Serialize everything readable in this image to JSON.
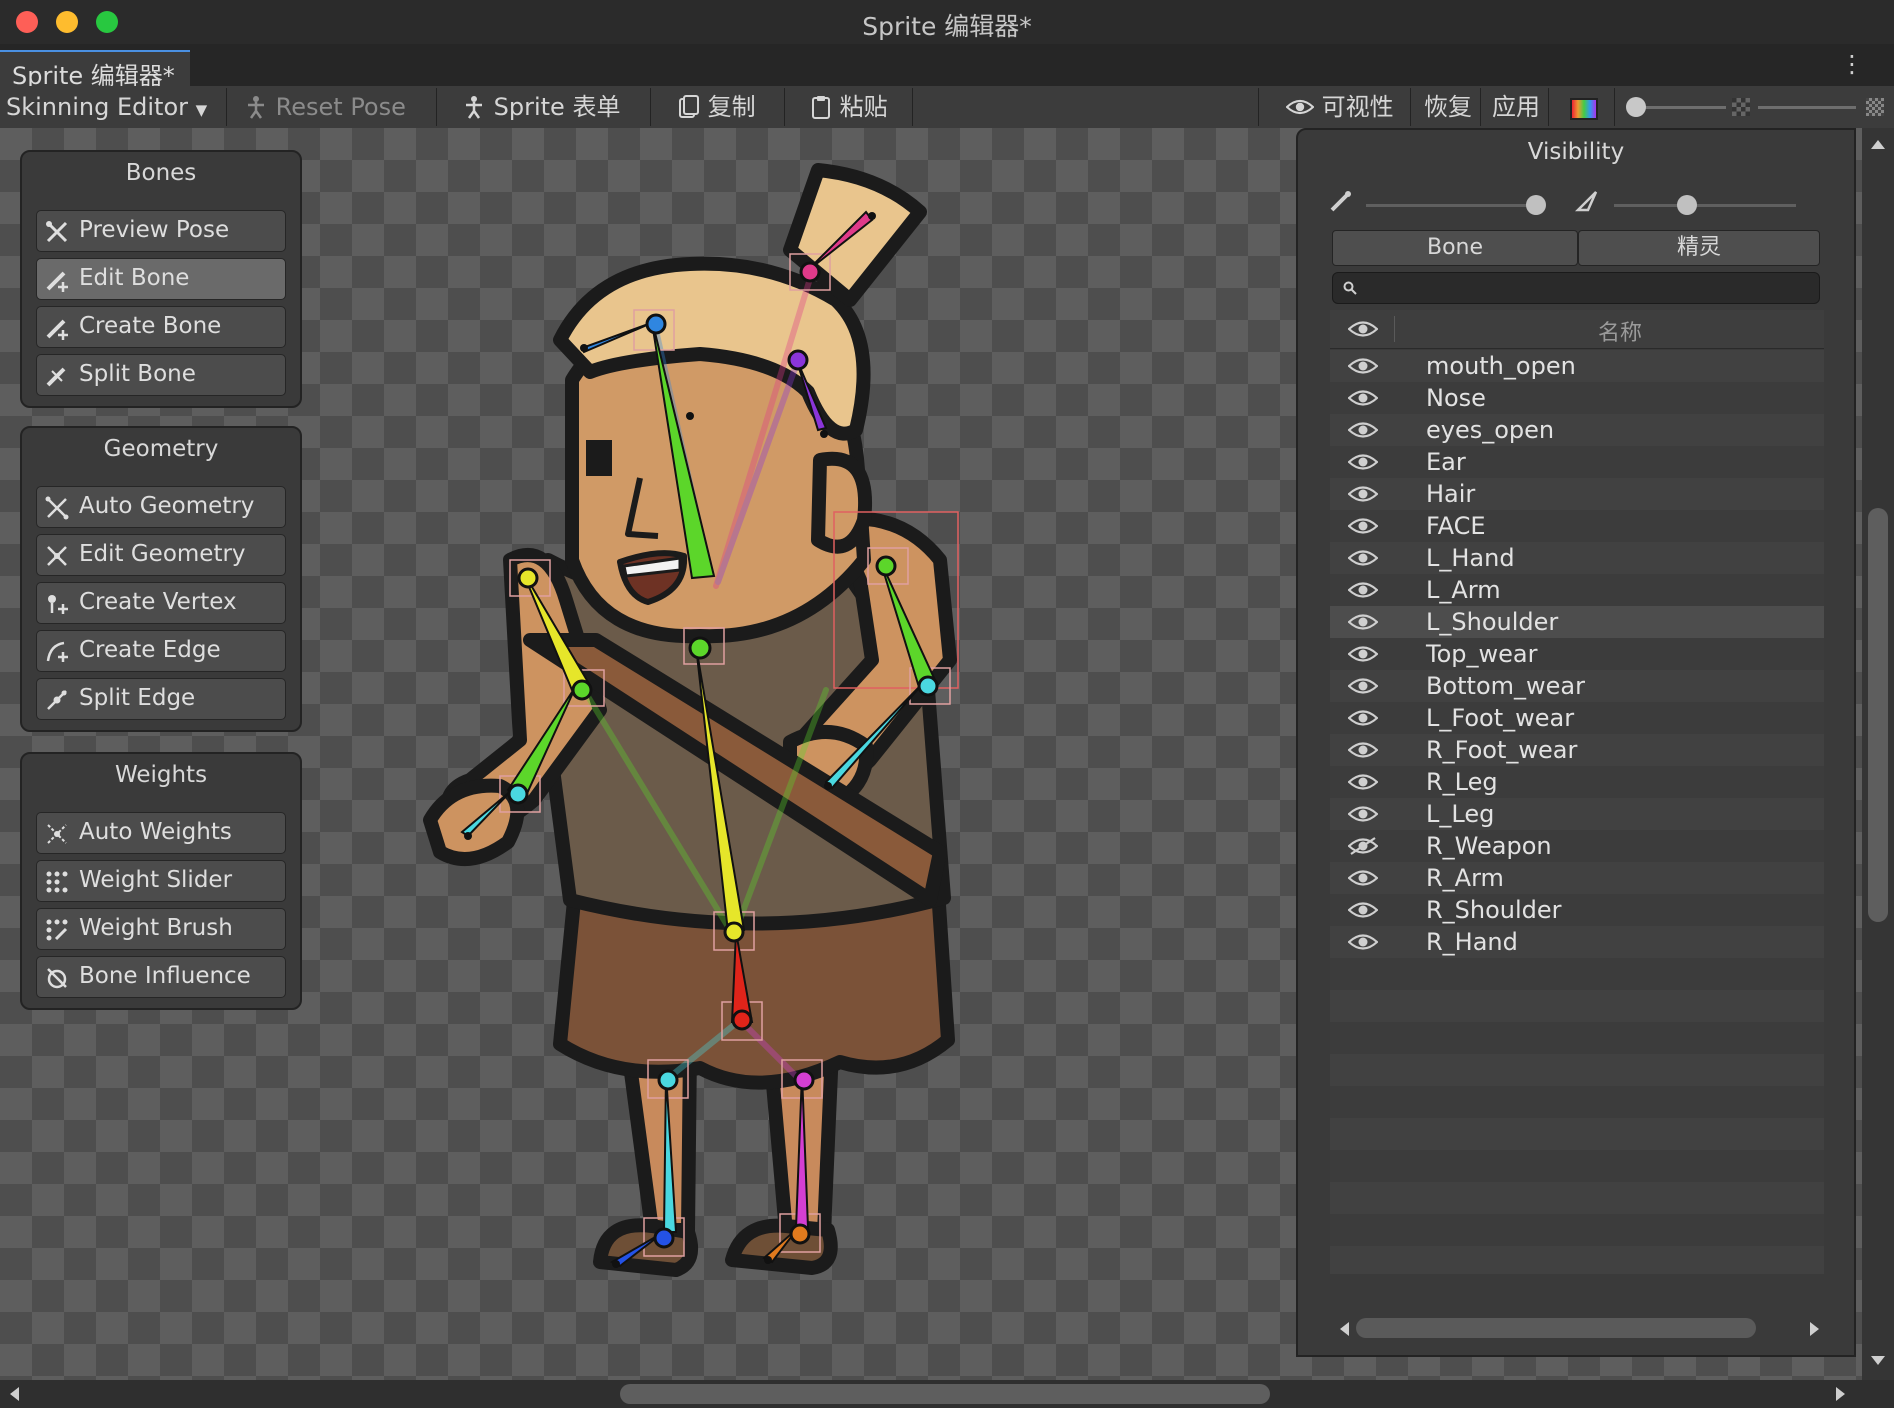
{
  "window": {
    "title": "Sprite 编辑器*"
  },
  "tab": {
    "label": "Sprite 编辑器*",
    "menu_glyph": "⋮"
  },
  "toolbar": {
    "mode_label": "Skinning Editor",
    "reset_pose": "Reset Pose",
    "sprite_sheet": "Sprite 表单",
    "copy": "复制",
    "paste": "粘贴",
    "visibility": "可视性",
    "revert": "恢复",
    "apply": "应用"
  },
  "panels": {
    "bones": {
      "title": "Bones",
      "tools": [
        "Preview Pose",
        "Edit Bone",
        "Create Bone",
        "Split Bone"
      ],
      "active": "Edit Bone"
    },
    "geometry": {
      "title": "Geometry",
      "tools": [
        "Auto Geometry",
        "Edit Geometry",
        "Create Vertex",
        "Create Edge",
        "Split Edge"
      ]
    },
    "weights": {
      "title": "Weights",
      "tools": [
        "Auto Weights",
        "Weight Slider",
        "Weight Brush",
        "Bone Influence"
      ]
    }
  },
  "visibility": {
    "title": "Visibility",
    "bone_opacity": 0.8,
    "mesh_opacity": 0.4,
    "tabs": [
      "Bone",
      "精灵"
    ],
    "search_placeholder": "",
    "column_header": "名称",
    "items": [
      {
        "name": "mouth_open",
        "visible": true
      },
      {
        "name": "Nose",
        "visible": true
      },
      {
        "name": "eyes_open",
        "visible": true
      },
      {
        "name": "Ear",
        "visible": true
      },
      {
        "name": "Hair",
        "visible": true
      },
      {
        "name": "FACE",
        "visible": true
      },
      {
        "name": "L_Hand",
        "visible": true
      },
      {
        "name": "L_Arm",
        "visible": true
      },
      {
        "name": "L_Shoulder",
        "visible": true,
        "selected": true
      },
      {
        "name": "Top_wear",
        "visible": true
      },
      {
        "name": "Bottom_wear",
        "visible": true
      },
      {
        "name": "L_Foot_wear",
        "visible": true
      },
      {
        "name": "R_Foot_wear",
        "visible": true
      },
      {
        "name": "R_Leg",
        "visible": true
      },
      {
        "name": "L_Leg",
        "visible": true
      },
      {
        "name": "R_Weapon",
        "visible": false
      },
      {
        "name": "R_Arm",
        "visible": true
      },
      {
        "name": "R_Shoulder",
        "visible": true
      },
      {
        "name": "R_Hand",
        "visible": true
      }
    ]
  },
  "colors": {
    "accent": "#4a90e2",
    "bone_green": "#5cd62a",
    "bone_yellow": "#e6e62a",
    "bone_cyan": "#4ad8e0",
    "bone_red": "#e0241a",
    "bone_magenta": "#d43fd2",
    "bone_blue": "#2452e6",
    "bone_orange": "#e07a1e",
    "bone_pink": "#e03a8a",
    "bone_purple": "#8a35d9",
    "bone_skyblue": "#2f86e0"
  }
}
